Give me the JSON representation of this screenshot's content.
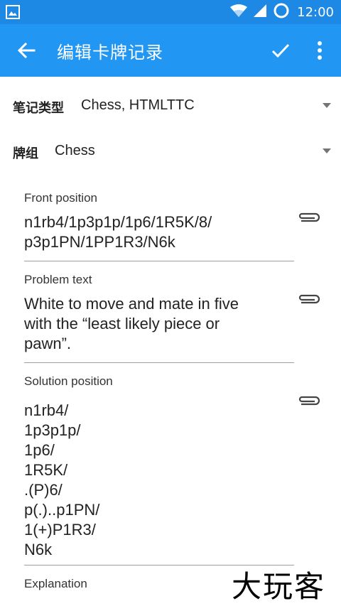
{
  "status_bar": {
    "time": "12:00"
  },
  "app_bar": {
    "title": "编辑卡牌记录"
  },
  "note_type": {
    "label": "笔记类型",
    "value": "Chess, HTMLTTC"
  },
  "deck": {
    "label": "牌组",
    "value": "Chess"
  },
  "fields": [
    {
      "label": "Front position",
      "value": "n1rb4/1p3p1p/1p6/1R5K/8/\np3p1PN/1PP1R3/N6k"
    },
    {
      "label": "Problem text",
      "value": "White to move and mate in five\nwith the “least likely piece or\npawn”."
    },
    {
      "label": "Solution position",
      "value": "n1rb4/\n1p3p1p/\n1p6/\n1R5K/\n.(P)6/\np(.)..p1PN/\n1(+)P1R3/\nN6k"
    },
    {
      "label": "Explanation",
      "value": ""
    }
  ],
  "watermark": "大玩客",
  "colors": {
    "status_bar": "#1e88e5",
    "app_bar": "#2196f3"
  }
}
